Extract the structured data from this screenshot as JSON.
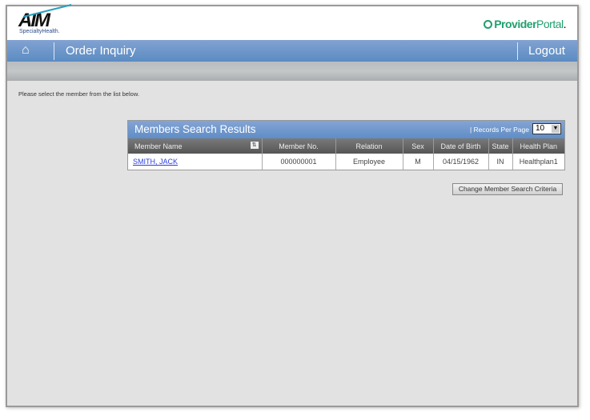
{
  "header": {
    "logo": "AIM",
    "logo_sub": "SpecialtyHealth.",
    "portal_bold": "Provider",
    "portal_light": "Portal",
    "portal_dot": "."
  },
  "nav": {
    "title": "Order Inquiry",
    "logout": "Logout"
  },
  "message": "Please select the member from the list below.",
  "results": {
    "title": "Members Search Results",
    "records_label": "|  Records Per Page",
    "records_value": "10",
    "columns": [
      "Member Name",
      "Member No.",
      "Relation",
      "Sex",
      "Date of Birth",
      "State",
      "Health Plan"
    ],
    "rows": [
      [
        "SMITH, JACK",
        "000000001",
        "Employee",
        "M",
        "04/15/1962",
        "IN",
        "Healthplan1"
      ]
    ]
  },
  "change_button": "Change Member Search Criteria"
}
